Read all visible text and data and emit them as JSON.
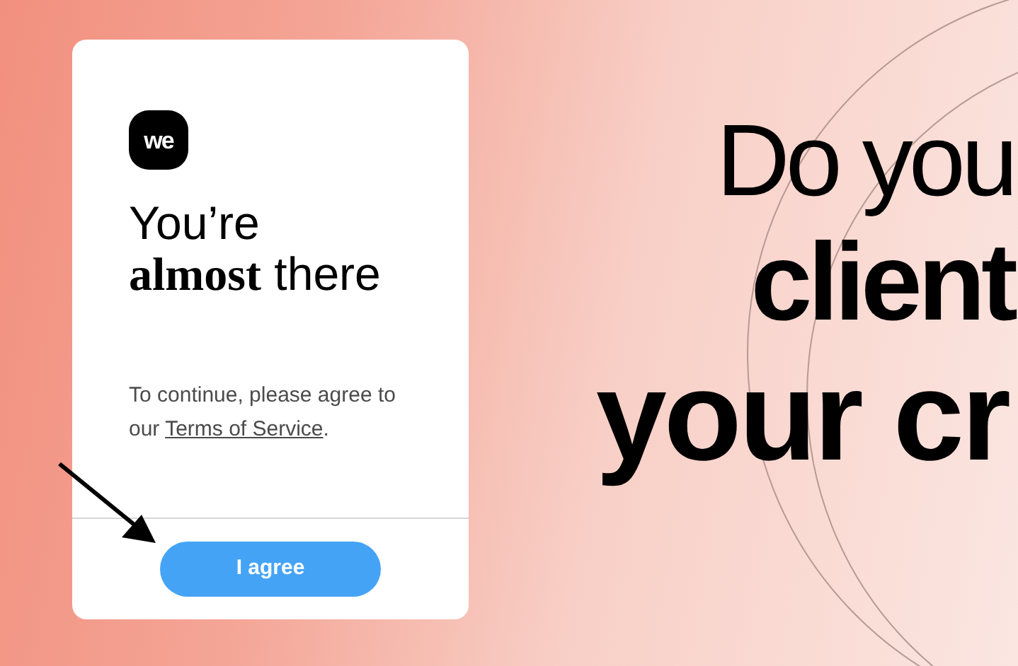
{
  "dialog": {
    "logo": "we",
    "title_lines": [
      "You’re",
      "**almost** there"
    ],
    "message": {
      "before": "To continue, please agree to our ",
      "link": "Terms of Service",
      "after": "."
    },
    "button": "I agree"
  },
  "headline_lines": [
    {
      "text": "Do you",
      "kind": "light"
    },
    {
      "text": "client",
      "kind": "bold"
    },
    {
      "text": "your cr",
      "kind": "large"
    }
  ]
}
